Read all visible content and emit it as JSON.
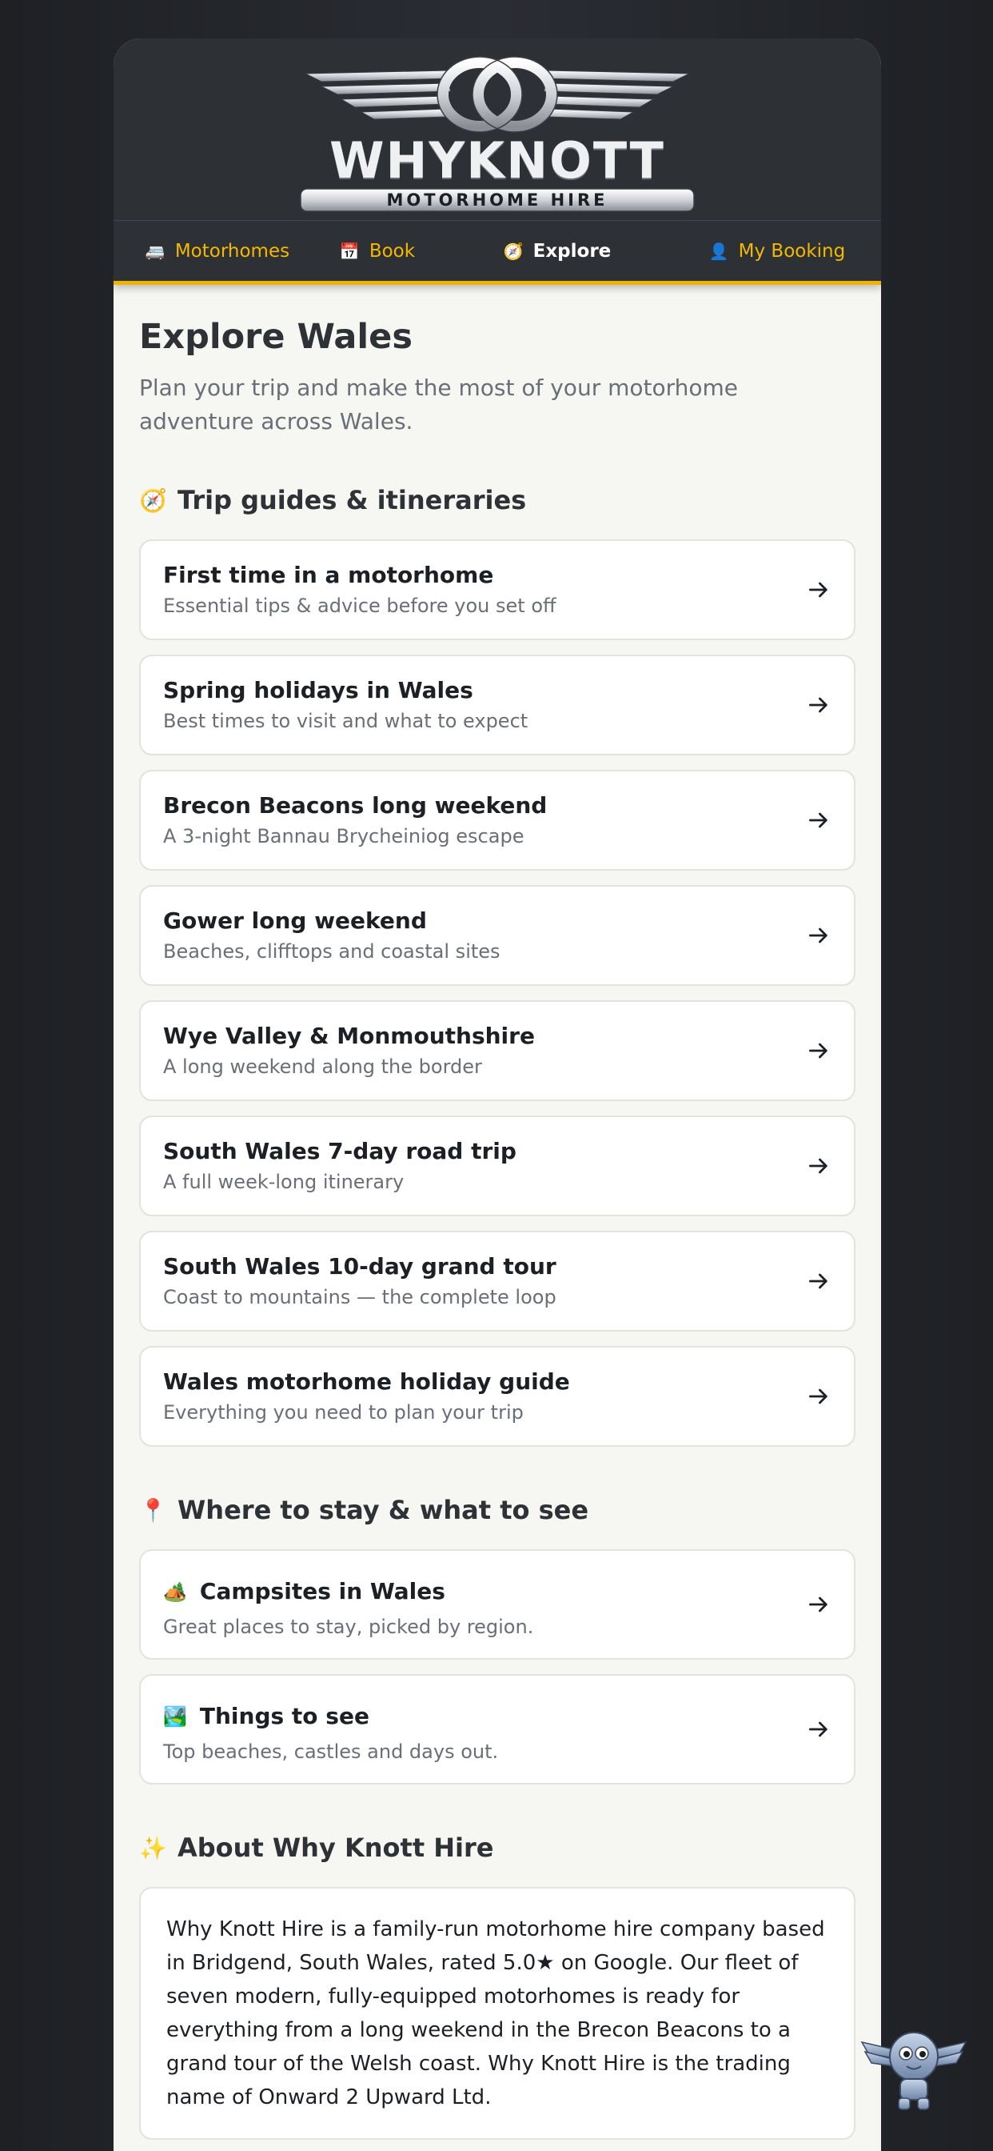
{
  "brand": {
    "name": "WHYKNOTT",
    "tagline": "MOTORHOME HIRE"
  },
  "nav": [
    {
      "icon": "🚐",
      "icon_name": "van-icon",
      "label": "Motorhomes"
    },
    {
      "icon": "📅",
      "icon_name": "calendar-icon",
      "label": "Book"
    },
    {
      "icon": "🧭",
      "icon_name": "compass-icon",
      "label": "Explore",
      "active": true
    },
    {
      "icon": "👤",
      "icon_name": "user-icon",
      "label": "My Booking"
    }
  ],
  "page": {
    "title": "Explore Wales",
    "subtitle": "Plan your trip and make the most of your motorhome adventure across Wales."
  },
  "sections": {
    "guides": {
      "icon": "🧭",
      "title": "Trip guides & itineraries",
      "items": [
        {
          "title": "First time in a motorhome",
          "subtitle": "Essential tips & advice before you set off"
        },
        {
          "title": "Spring holidays in Wales",
          "subtitle": "Best times to visit and what to expect"
        },
        {
          "title": "Brecon Beacons long weekend",
          "subtitle": "A 3-night Bannau Brycheiniog escape"
        },
        {
          "title": "Gower long weekend",
          "subtitle": "Beaches, clifftops and coastal sites"
        },
        {
          "title": "Wye Valley & Monmouthshire",
          "subtitle": "A long weekend along the border"
        },
        {
          "title": "South Wales 7-day road trip",
          "subtitle": "A full week-long itinerary"
        },
        {
          "title": "South Wales 10-day grand tour",
          "subtitle": "Coast to mountains — the complete loop"
        },
        {
          "title": "Wales motorhome holiday guide",
          "subtitle": "Everything you need to plan your trip"
        }
      ]
    },
    "stay": {
      "icon": "📍",
      "title": "Where to stay & what to see",
      "items": [
        {
          "emoji": "🏕️",
          "title": "Campsites in Wales",
          "subtitle": "Great places to stay, picked by region."
        },
        {
          "emoji": "🏞️",
          "title": "Things to see",
          "subtitle": "Top beaches, castles and days out."
        }
      ]
    },
    "about": {
      "icon": "✨",
      "title": "About Why Knott Hire",
      "text": "Why Knott Hire is a family-run motorhome hire company based in Bridgend, South Wales, rated 5.0★ on Google. Our fleet of seven modern, fully-equipped motorhomes is ready for everything from a long weekend in the Brecon Beacons to a grand tour of the Welsh coast. Why Knott Hire is the trading name of Onward 2 Upward Ltd."
    }
  },
  "colors": {
    "accent": "#f5b800",
    "header_bg": "#2d3035",
    "page_bg": "#f6f6f2",
    "text_dark": "#1c1f24",
    "text_muted": "#6a6e76"
  }
}
